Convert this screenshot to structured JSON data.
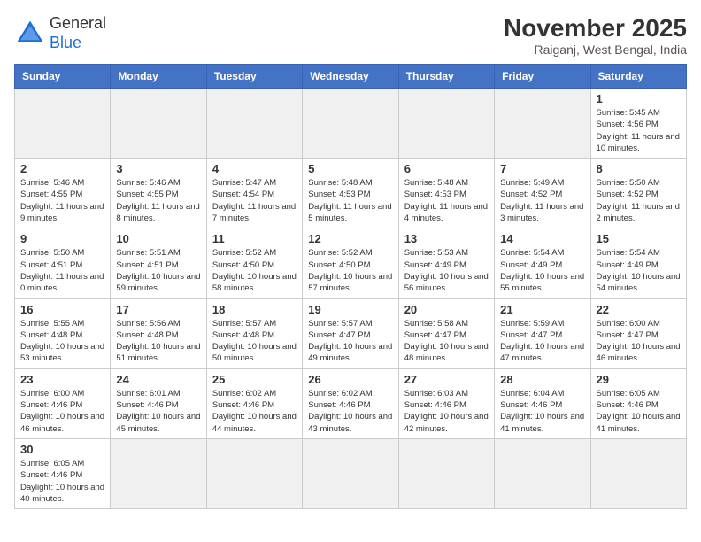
{
  "header": {
    "logo_general": "General",
    "logo_blue": "Blue",
    "month_year": "November 2025",
    "location": "Raiganj, West Bengal, India"
  },
  "weekdays": [
    "Sunday",
    "Monday",
    "Tuesday",
    "Wednesday",
    "Thursday",
    "Friday",
    "Saturday"
  ],
  "days": [
    {
      "day": "",
      "info": ""
    },
    {
      "day": "",
      "info": ""
    },
    {
      "day": "",
      "info": ""
    },
    {
      "day": "",
      "info": ""
    },
    {
      "day": "",
      "info": ""
    },
    {
      "day": "",
      "info": ""
    },
    {
      "day": "1",
      "info": "Sunrise: 5:45 AM\nSunset: 4:56 PM\nDaylight: 11 hours and 10 minutes."
    },
    {
      "day": "2",
      "info": "Sunrise: 5:46 AM\nSunset: 4:55 PM\nDaylight: 11 hours and 9 minutes."
    },
    {
      "day": "3",
      "info": "Sunrise: 5:46 AM\nSunset: 4:55 PM\nDaylight: 11 hours and 8 minutes."
    },
    {
      "day": "4",
      "info": "Sunrise: 5:47 AM\nSunset: 4:54 PM\nDaylight: 11 hours and 7 minutes."
    },
    {
      "day": "5",
      "info": "Sunrise: 5:48 AM\nSunset: 4:53 PM\nDaylight: 11 hours and 5 minutes."
    },
    {
      "day": "6",
      "info": "Sunrise: 5:48 AM\nSunset: 4:53 PM\nDaylight: 11 hours and 4 minutes."
    },
    {
      "day": "7",
      "info": "Sunrise: 5:49 AM\nSunset: 4:52 PM\nDaylight: 11 hours and 3 minutes."
    },
    {
      "day": "8",
      "info": "Sunrise: 5:50 AM\nSunset: 4:52 PM\nDaylight: 11 hours and 2 minutes."
    },
    {
      "day": "9",
      "info": "Sunrise: 5:50 AM\nSunset: 4:51 PM\nDaylight: 11 hours and 0 minutes."
    },
    {
      "day": "10",
      "info": "Sunrise: 5:51 AM\nSunset: 4:51 PM\nDaylight: 10 hours and 59 minutes."
    },
    {
      "day": "11",
      "info": "Sunrise: 5:52 AM\nSunset: 4:50 PM\nDaylight: 10 hours and 58 minutes."
    },
    {
      "day": "12",
      "info": "Sunrise: 5:52 AM\nSunset: 4:50 PM\nDaylight: 10 hours and 57 minutes."
    },
    {
      "day": "13",
      "info": "Sunrise: 5:53 AM\nSunset: 4:49 PM\nDaylight: 10 hours and 56 minutes."
    },
    {
      "day": "14",
      "info": "Sunrise: 5:54 AM\nSunset: 4:49 PM\nDaylight: 10 hours and 55 minutes."
    },
    {
      "day": "15",
      "info": "Sunrise: 5:54 AM\nSunset: 4:49 PM\nDaylight: 10 hours and 54 minutes."
    },
    {
      "day": "16",
      "info": "Sunrise: 5:55 AM\nSunset: 4:48 PM\nDaylight: 10 hours and 53 minutes."
    },
    {
      "day": "17",
      "info": "Sunrise: 5:56 AM\nSunset: 4:48 PM\nDaylight: 10 hours and 51 minutes."
    },
    {
      "day": "18",
      "info": "Sunrise: 5:57 AM\nSunset: 4:48 PM\nDaylight: 10 hours and 50 minutes."
    },
    {
      "day": "19",
      "info": "Sunrise: 5:57 AM\nSunset: 4:47 PM\nDaylight: 10 hours and 49 minutes."
    },
    {
      "day": "20",
      "info": "Sunrise: 5:58 AM\nSunset: 4:47 PM\nDaylight: 10 hours and 48 minutes."
    },
    {
      "day": "21",
      "info": "Sunrise: 5:59 AM\nSunset: 4:47 PM\nDaylight: 10 hours and 47 minutes."
    },
    {
      "day": "22",
      "info": "Sunrise: 6:00 AM\nSunset: 4:47 PM\nDaylight: 10 hours and 46 minutes."
    },
    {
      "day": "23",
      "info": "Sunrise: 6:00 AM\nSunset: 4:46 PM\nDaylight: 10 hours and 46 minutes."
    },
    {
      "day": "24",
      "info": "Sunrise: 6:01 AM\nSunset: 4:46 PM\nDaylight: 10 hours and 45 minutes."
    },
    {
      "day": "25",
      "info": "Sunrise: 6:02 AM\nSunset: 4:46 PM\nDaylight: 10 hours and 44 minutes."
    },
    {
      "day": "26",
      "info": "Sunrise: 6:02 AM\nSunset: 4:46 PM\nDaylight: 10 hours and 43 minutes."
    },
    {
      "day": "27",
      "info": "Sunrise: 6:03 AM\nSunset: 4:46 PM\nDaylight: 10 hours and 42 minutes."
    },
    {
      "day": "28",
      "info": "Sunrise: 6:04 AM\nSunset: 4:46 PM\nDaylight: 10 hours and 41 minutes."
    },
    {
      "day": "29",
      "info": "Sunrise: 6:05 AM\nSunset: 4:46 PM\nDaylight: 10 hours and 41 minutes."
    },
    {
      "day": "30",
      "info": "Sunrise: 6:05 AM\nSunset: 4:46 PM\nDaylight: 10 hours and 40 minutes."
    },
    {
      "day": "",
      "info": ""
    },
    {
      "day": "",
      "info": ""
    },
    {
      "day": "",
      "info": ""
    },
    {
      "day": "",
      "info": ""
    },
    {
      "day": "",
      "info": ""
    },
    {
      "day": "",
      "info": ""
    }
  ]
}
